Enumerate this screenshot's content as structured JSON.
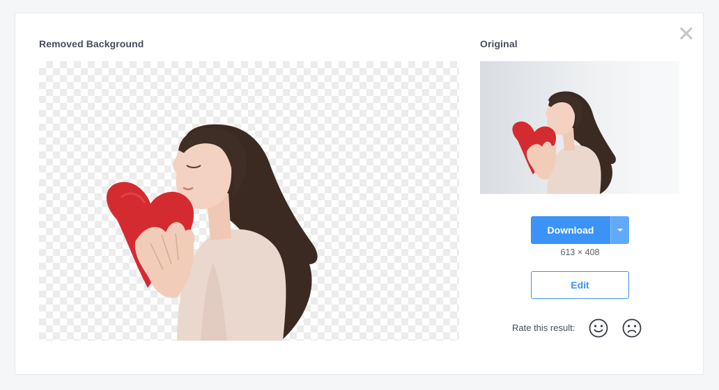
{
  "dialog": {
    "result_title": "Removed Background",
    "original_title": "Original",
    "close_icon": "close-icon"
  },
  "result": {
    "background": "transparent-checkerboard",
    "subject": "woman holding red heart"
  },
  "actions": {
    "download_label": "Download",
    "dropdown_icon": "caret-down-icon",
    "size_text": "613 × 408",
    "edit_label": "Edit"
  },
  "rating": {
    "label": "Rate this result:",
    "happy_icon": "smiley-face-icon",
    "sad_icon": "sad-face-icon"
  },
  "colors": {
    "accent": "#3b93f7",
    "accent_light": "#62aaf9",
    "title_text": "#454d59",
    "heart_red": "#d42b31"
  }
}
